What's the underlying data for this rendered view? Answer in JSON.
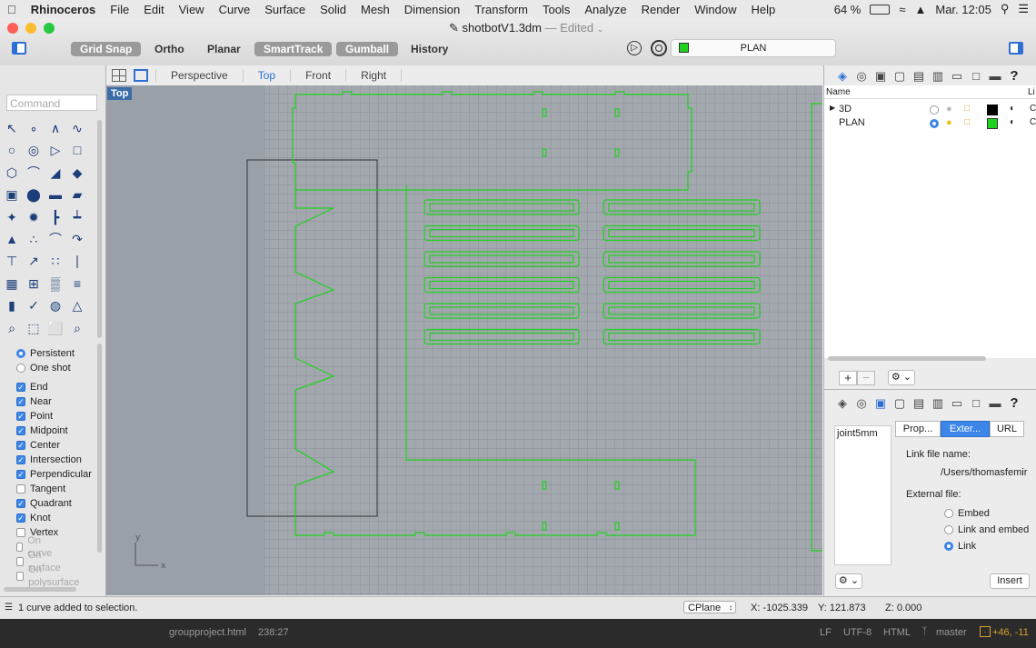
{
  "menubar": {
    "apple": "",
    "app": "Rhinoceros",
    "items": [
      "File",
      "Edit",
      "View",
      "Curve",
      "Surface",
      "Solid",
      "Mesh",
      "Dimension",
      "Transform",
      "Tools",
      "Analyze",
      "Render",
      "Window",
      "Help"
    ],
    "battery": "64 %",
    "clock": "Mar. 12:05"
  },
  "window": {
    "title": "shotbotV1.3dm",
    "edited": "— Edited"
  },
  "modes": {
    "grid_snap": "Grid Snap",
    "ortho": "Ortho",
    "planar": "Planar",
    "smarttrack": "SmartTrack",
    "gumball": "Gumball",
    "history": "History"
  },
  "cplane_display": "PLAN",
  "command": {
    "placeholder": "Command"
  },
  "view_tabs": [
    "Perspective",
    "Top",
    "Front",
    "Right"
  ],
  "active_view": "Top",
  "osnap": {
    "persistent": "Persistent",
    "one_shot": "One shot",
    "items": [
      {
        "label": "End",
        "checked": true
      },
      {
        "label": "Near",
        "checked": true
      },
      {
        "label": "Point",
        "checked": true
      },
      {
        "label": "Midpoint",
        "checked": true
      },
      {
        "label": "Center",
        "checked": true
      },
      {
        "label": "Intersection",
        "checked": true
      },
      {
        "label": "Perpendicular",
        "checked": true
      },
      {
        "label": "Tangent",
        "checked": false
      },
      {
        "label": "Quadrant",
        "checked": true
      },
      {
        "label": "Knot",
        "checked": true
      },
      {
        "label": "Vertex",
        "checked": false
      },
      {
        "label": "On curve",
        "checked": false,
        "disabled": true
      },
      {
        "label": "On surface",
        "checked": false,
        "disabled": true
      },
      {
        "label": "On polysurface",
        "checked": false,
        "disabled": true
      }
    ]
  },
  "layers": {
    "header_name": "Name",
    "header_trunc": "Li",
    "rows": [
      {
        "name": "3D",
        "color": "#000000",
        "current": false
      },
      {
        "name": "PLAN",
        "color": "#00d000",
        "current": true
      }
    ]
  },
  "properties": {
    "list_item": "joint5mm",
    "tabs": [
      "Prop...",
      "Exter...",
      "URL"
    ],
    "link_file_label": "Link file name:",
    "link_file_value": "/Users/thomasfemir",
    "external_label": "External file:",
    "options": [
      "Embed",
      "Link and embed",
      "Link"
    ],
    "selected": "Link",
    "insert": "Insert"
  },
  "status": {
    "message": "1 curve added to selection.",
    "cplane": "CPlane",
    "x": "X: -1025.339",
    "y": "Y: 121.873",
    "z": "Z: 0.000"
  },
  "editor": {
    "file": "groupproject.html",
    "pos": "238:27",
    "lf": "LF",
    "enc": "UTF-8",
    "lang": "HTML",
    "branch": "master",
    "diff": "+46, -11"
  },
  "colors": {
    "curve": "#1fd21f",
    "accent": "#3b86e8"
  }
}
